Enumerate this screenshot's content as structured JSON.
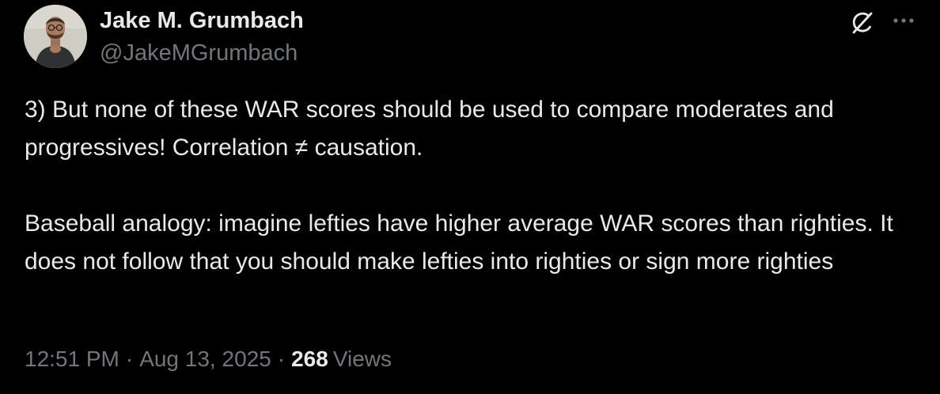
{
  "author": {
    "name": "Jake M. Grumbach",
    "handle": "@JakeMGrumbach",
    "avatar": "avatar-photo"
  },
  "header_icons": {
    "grok": "grok-icon",
    "more": "more-dots-icon"
  },
  "tweet": {
    "paragraphs": [
      "3) But none of these WAR scores should be used to compare moderates and progressives! Correlation ≠ causation.",
      "Baseball analogy: imagine lefties have higher average WAR scores than righties. It does not follow that you should make lefties into righties or sign more righties"
    ]
  },
  "meta": {
    "time": "12:51 PM",
    "separator": "·",
    "date": "Aug 13, 2025",
    "views_count": "268",
    "views_label": "Views"
  },
  "colors": {
    "background": "#000000",
    "text": "#e7e9ea",
    "secondary": "#71767b"
  }
}
